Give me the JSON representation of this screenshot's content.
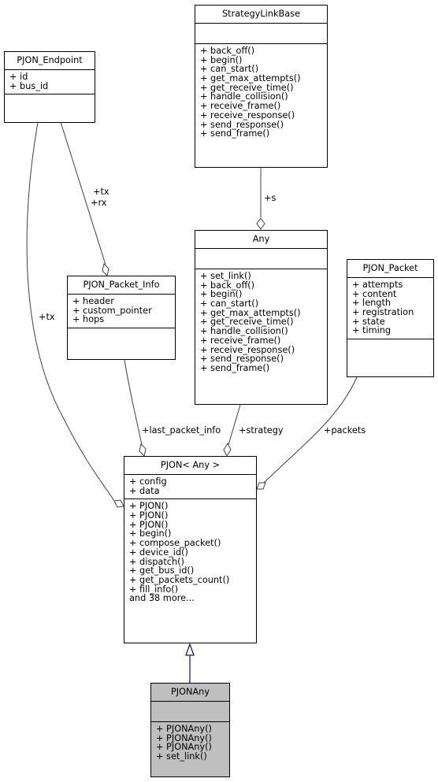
{
  "classes": {
    "strategy_link_base": {
      "name": "StrategyLinkBase",
      "attributes": [],
      "methods": [
        "+ back_off()",
        "+ begin()",
        "+ can_start()",
        "+ get_max_attempts()",
        "+ get_receive_time()",
        "+ handle_collision()",
        "+ receive_frame()",
        "+ receive_response()",
        "+ send_response()",
        "+ send_frame()"
      ]
    },
    "pjon_endpoint": {
      "name": "PJON_Endpoint",
      "attributes": [
        "+ id",
        "+ bus_id"
      ],
      "methods": []
    },
    "any": {
      "name": "Any",
      "attributes": [],
      "methods": [
        "+ set_link()",
        "+ back_off()",
        "+ begin()",
        "+ can_start()",
        "+ get_max_attempts()",
        "+ get_receive_time()",
        "+ handle_collision()",
        "+ receive_frame()",
        "+ receive_response()",
        "+ send_response()",
        "+ send_frame()"
      ]
    },
    "pjon_packet_info": {
      "name": "PJON_Packet_Info",
      "attributes": [
        "+ header",
        "+ custom_pointer",
        "+ hops"
      ],
      "methods": []
    },
    "pjon_packet": {
      "name": "PJON_Packet",
      "attributes": [
        "+ attempts",
        "+ content",
        "+ length",
        "+ registration",
        "+ state",
        "+ timing"
      ],
      "methods": []
    },
    "pjon_any_template": {
      "name": "PJON< Any >",
      "attributes": [
        "+ config",
        "+ data"
      ],
      "methods": [
        "+ PJON()",
        "+ PJON()",
        "+ PJON()",
        "+ begin()",
        "+ compose_packet()",
        "+ device_id()",
        "+ dispatch()",
        "+ get_bus_id()",
        "+ get_packets_count()",
        "+ fill_info()",
        "and 38 more..."
      ]
    },
    "pjonany": {
      "name": "PJONAny",
      "attributes": [],
      "methods": [
        "+ PJONAny()",
        "+ PJONAny()",
        "+ PJONAny()",
        "+ set_link()"
      ]
    }
  },
  "edge_labels": {
    "s": "+s",
    "tx_rx_line1": "+tx",
    "tx_rx_line2": "+rx",
    "tx": "+tx",
    "last_packet_info": "+last_packet_info",
    "strategy": "+strategy",
    "packets": "+packets"
  },
  "colors": {
    "edge": "#404040",
    "inheritance_edge": "#191970",
    "highlight_fill": "#bfbfbf"
  }
}
